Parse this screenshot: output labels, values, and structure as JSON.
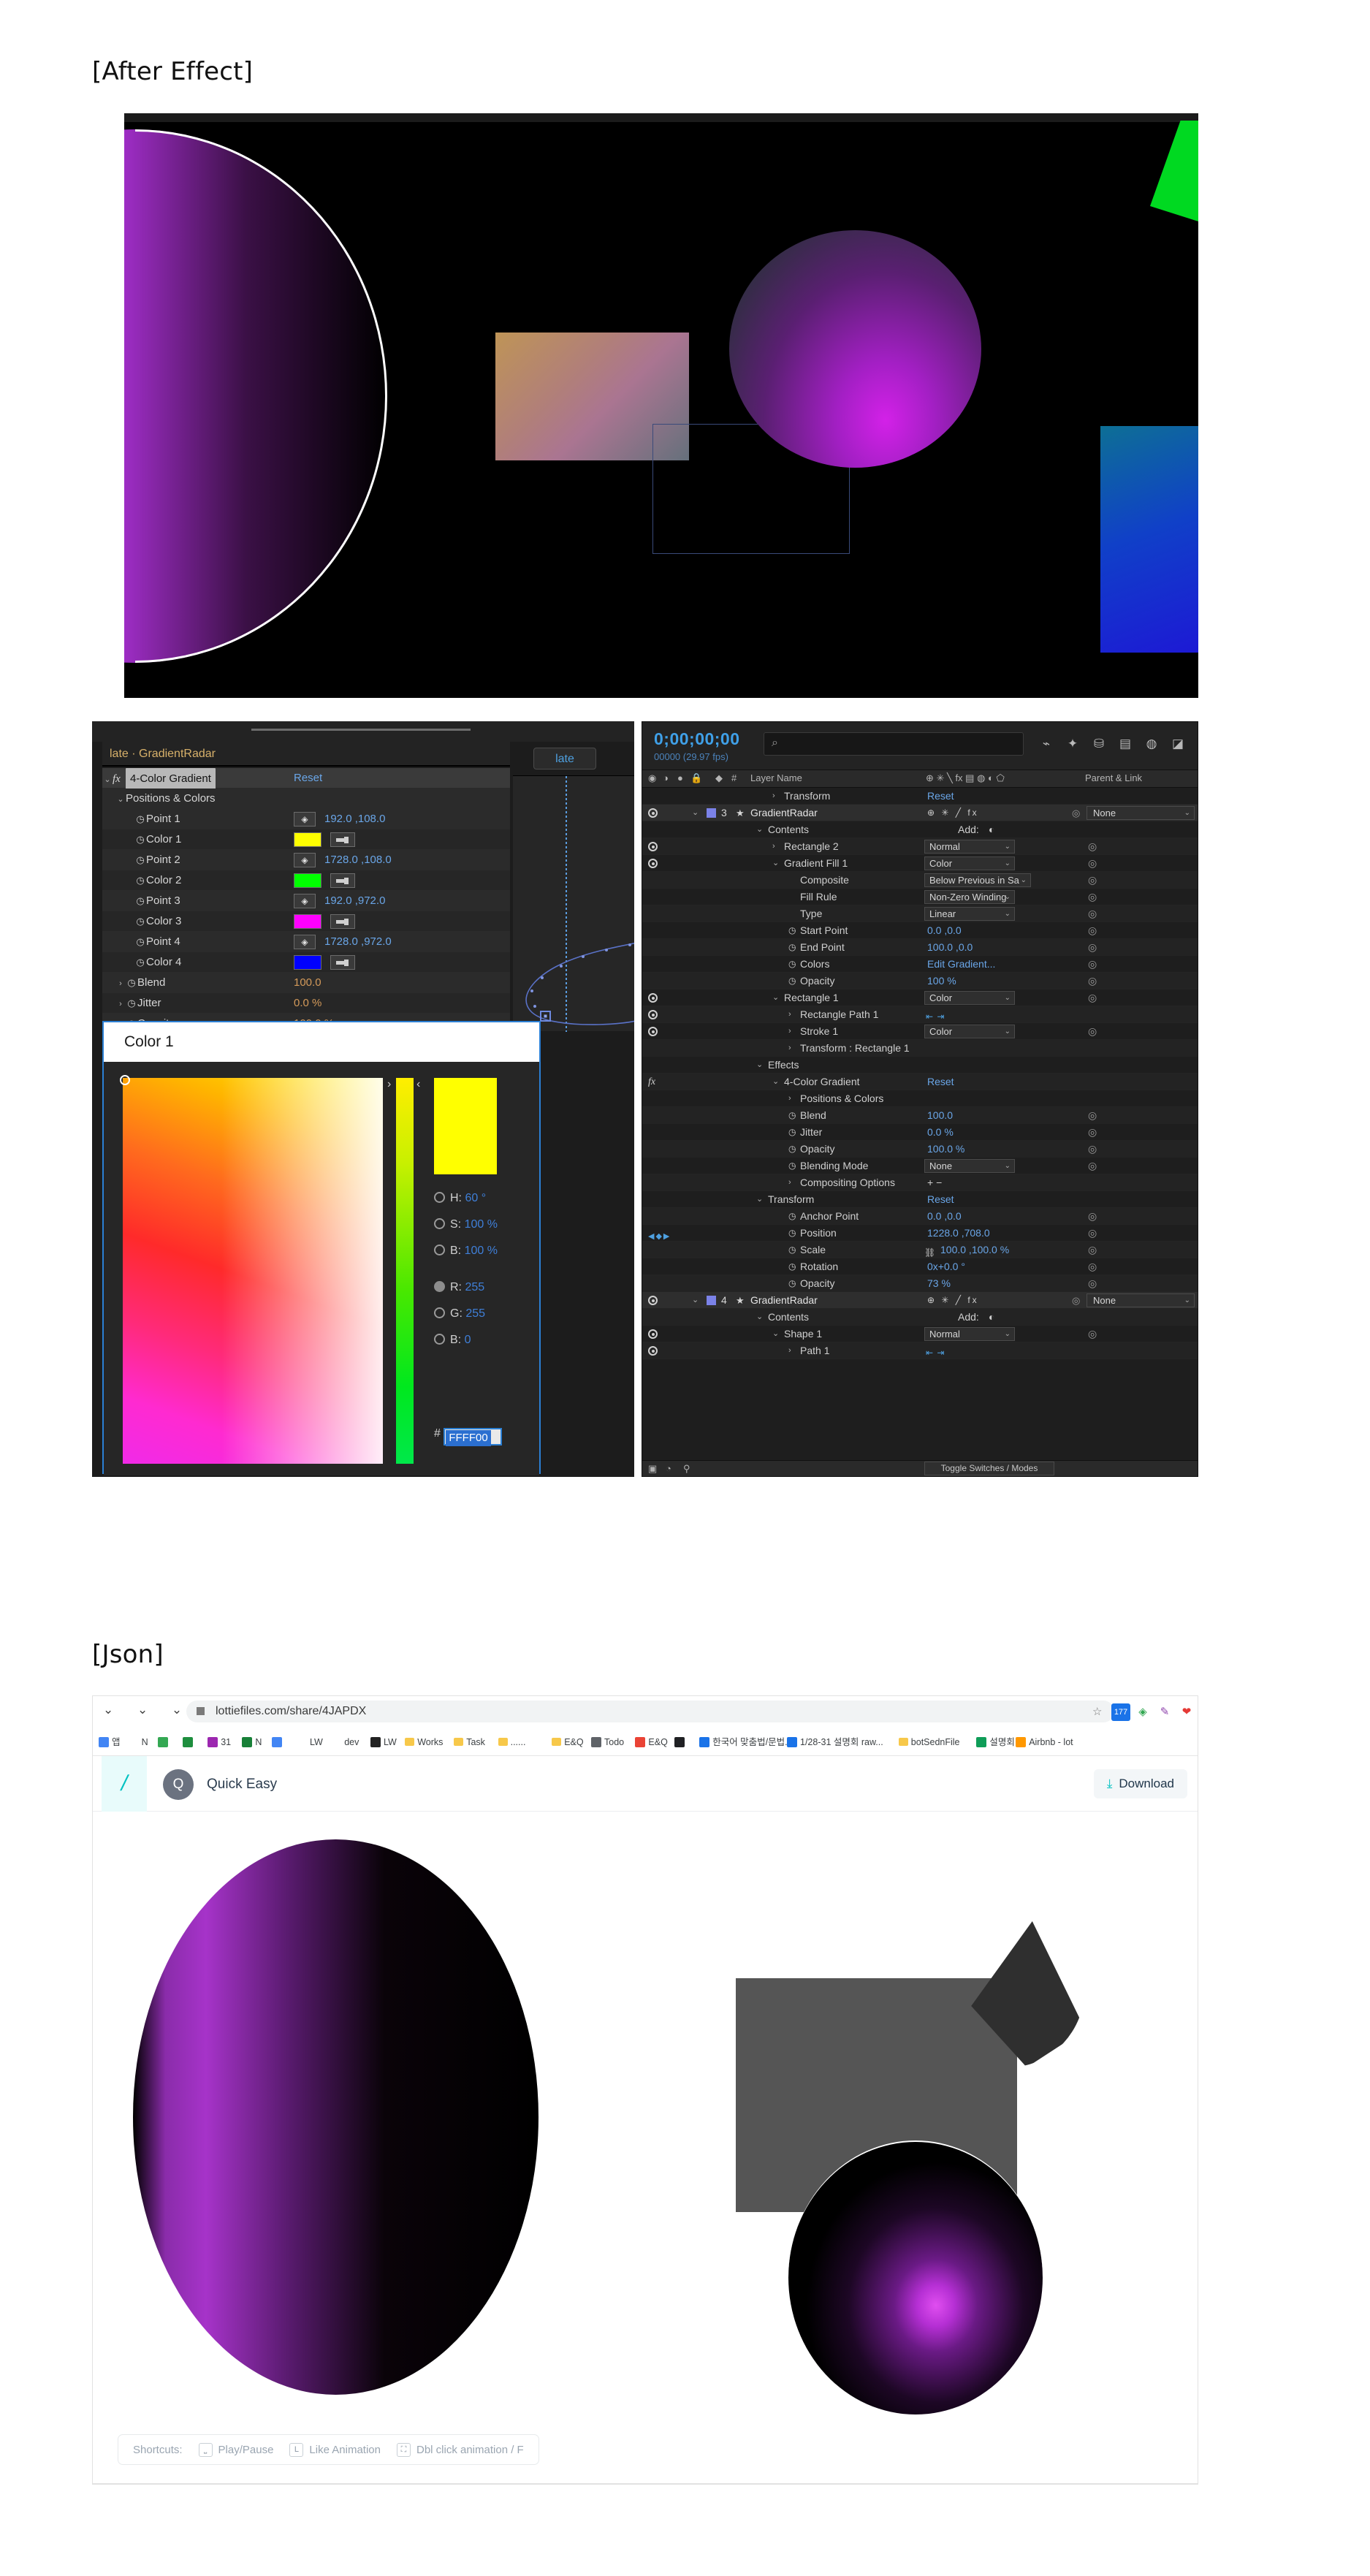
{
  "captions": {
    "after_effect": "[After Effect]",
    "json": "[Json]"
  },
  "after_effects": {
    "effect_controls": {
      "breadcrumb": "late · GradientRadar",
      "effect_name": "4-Color Gradient",
      "reset_label": "Reset",
      "group_label": "Positions & Colors",
      "rows": [
        {
          "label": "Point 1",
          "value": "192.0 ,108.0",
          "kind": "point"
        },
        {
          "label": "Color 1",
          "value": "#FFFF00",
          "kind": "color"
        },
        {
          "label": "Point 2",
          "value": "1728.0 ,108.0",
          "kind": "point"
        },
        {
          "label": "Color 2",
          "value": "#00FF00",
          "kind": "color"
        },
        {
          "label": "Point 3",
          "value": "192.0 ,972.0",
          "kind": "point"
        },
        {
          "label": "Color 3",
          "value": "#FF00FF",
          "kind": "color"
        },
        {
          "label": "Point 4",
          "value": "1728.0 ,972.0",
          "kind": "point"
        },
        {
          "label": "Color 4",
          "value": "#0000FF",
          "kind": "color"
        }
      ],
      "blend_label": "Blend",
      "blend_value": "100.0",
      "jitter_label": "Jitter",
      "jitter_value": "0.0 %",
      "opacity_label": "Opacity",
      "opacity_value": "100.0 %",
      "blending_mode_label": "Blending Mode",
      "blending_mode_value": "None"
    },
    "motion_path": {
      "tab_label": "late"
    },
    "color_picker": {
      "title": "Color 1",
      "hue_label": "H:",
      "hue_value": "60 °",
      "sat_label": "S:",
      "sat_value": "100 %",
      "bri_label": "B:",
      "bri_value": "100 %",
      "red_label": "R:",
      "red_value": "255",
      "green_label": "G:",
      "green_value": "255",
      "blue_label": "B:",
      "blue_value": "0",
      "hash_label": "#",
      "hex_value": "FFFF00",
      "preview_color": "#FFFF00"
    },
    "timeline": {
      "timecode": "0;00;00;00",
      "frame_info": "00000 (29.97 fps)",
      "search_placeholder": "",
      "columns": {
        "layer_name": "Layer Name",
        "parent_link": "Parent & Link"
      },
      "toggle_switches": "Toggle Switches / Modes",
      "add_label": "Add:",
      "rows": [
        {
          "indent": 3,
          "label": "Transform",
          "value": "Reset",
          "type": "reset",
          "chev": "›"
        },
        {
          "indent": 0,
          "label": "GradientRadar",
          "type": "layer",
          "number": "3",
          "parent": "None",
          "switches": "⊕ ✳ ╱ fx"
        },
        {
          "indent": 2,
          "label": "Contents",
          "type": "add",
          "chev": "⌄"
        },
        {
          "indent": 3,
          "label": "Rectangle 2",
          "value": "Normal",
          "type": "dropdown",
          "chev": "›",
          "eye": true
        },
        {
          "indent": 3,
          "label": "Gradient Fill 1",
          "value": "Color",
          "type": "dropdown",
          "chev": "⌄",
          "eye": true
        },
        {
          "indent": 4,
          "label": "Composite",
          "value": "Below Previous in Sa",
          "type": "dropdown"
        },
        {
          "indent": 4,
          "label": "Fill Rule",
          "value": "Non-Zero Winding",
          "type": "dropdown"
        },
        {
          "indent": 4,
          "label": "Type",
          "value": "Linear",
          "type": "dropdown"
        },
        {
          "indent": 4,
          "label": "Start Point",
          "value": "0.0 ,0.0",
          "type": "value",
          "stop": true
        },
        {
          "indent": 4,
          "label": "End Point",
          "value": "100.0 ,0.0",
          "type": "value",
          "stop": true
        },
        {
          "indent": 4,
          "label": "Colors",
          "value": "Edit Gradient...",
          "type": "value",
          "stop": true
        },
        {
          "indent": 4,
          "label": "Opacity",
          "value": "100 %",
          "type": "value",
          "stop": true
        },
        {
          "indent": 3,
          "label": "Rectangle 1",
          "value": "Color",
          "type": "dropdown",
          "chev": "⌄",
          "eye": true
        },
        {
          "indent": 4,
          "label": "Rectangle Path 1",
          "type": "pathicons",
          "chev": "›",
          "eye": true
        },
        {
          "indent": 4,
          "label": "Stroke 1",
          "value": "Color",
          "type": "dropdown",
          "chev": "›",
          "eye": true
        },
        {
          "indent": 4,
          "label": "Transform : Rectangle 1",
          "type": "plain",
          "chev": "›"
        },
        {
          "indent": 2,
          "label": "Effects",
          "type": "plain",
          "chev": "⌄"
        },
        {
          "indent": 3,
          "label": "4-Color Gradient",
          "value": "Reset",
          "type": "reset",
          "chev": "⌄",
          "fx": true
        },
        {
          "indent": 4,
          "label": "Positions & Colors",
          "type": "plain",
          "chev": "›"
        },
        {
          "indent": 4,
          "label": "Blend",
          "value": "100.0",
          "type": "value",
          "stop": true
        },
        {
          "indent": 4,
          "label": "Jitter",
          "value": "0.0 %",
          "type": "value",
          "stop": true
        },
        {
          "indent": 4,
          "label": "Opacity",
          "value": "100.0 %",
          "type": "value",
          "stop": true
        },
        {
          "indent": 4,
          "label": "Blending Mode",
          "value": "None",
          "type": "dropdown",
          "stop": true
        },
        {
          "indent": 4,
          "label": "Compositing Options",
          "value": "+ −",
          "type": "plainval",
          "chev": "›"
        },
        {
          "indent": 2,
          "label": "Transform",
          "value": "Reset",
          "type": "reset",
          "chev": "⌄"
        },
        {
          "indent": 4,
          "label": "Anchor Point",
          "value": "0.0 ,0.0",
          "type": "value",
          "stop": true
        },
        {
          "indent": 4,
          "label": "Position",
          "value": "1228.0 ,708.0",
          "type": "value",
          "stop": true,
          "keyframe": true
        },
        {
          "indent": 4,
          "label": "Scale",
          "value": "100.0 ,100.0 %",
          "type": "value",
          "stop": true,
          "link": true
        },
        {
          "indent": 4,
          "label": "Rotation",
          "value": "0x+0.0 °",
          "type": "value",
          "stop": true
        },
        {
          "indent": 4,
          "label": "Opacity",
          "value": "73 %",
          "type": "value",
          "stop": true
        },
        {
          "indent": 0,
          "label": "GradientRadar",
          "type": "layer",
          "number": "4",
          "parent": "None",
          "switches": "⊕ ✳ ╱ fx"
        },
        {
          "indent": 2,
          "label": "Contents",
          "type": "add",
          "chev": "⌄"
        },
        {
          "indent": 3,
          "label": "Shape 1",
          "value": "Normal",
          "type": "dropdown",
          "chev": "⌄",
          "eye": true
        },
        {
          "indent": 4,
          "label": "Path 1",
          "type": "pathicons",
          "chev": "›",
          "eye": true
        }
      ]
    }
  },
  "json_section": {
    "browser": {
      "url": "lottiefiles.com/share/4JAPDX",
      "bookmarks": [
        {
          "label": "앱",
          "color": "#4285f4",
          "kind": "apps"
        },
        {
          "label": "N",
          "color": "#ffffff",
          "kind": "letter"
        },
        {
          "label": "",
          "color": "#34a853",
          "kind": "sq"
        },
        {
          "label": "",
          "color": "#1e8e3e",
          "kind": "sq"
        },
        {
          "label": "31",
          "color": "#9c27b0",
          "kind": "sq"
        },
        {
          "label": "N",
          "color": "#188038",
          "kind": "sq"
        },
        {
          "label": "",
          "color": "#4285f4",
          "kind": "sq"
        },
        {
          "label": "LW",
          "color": "#ffffff",
          "kind": "letter"
        },
        {
          "label": "dev",
          "color": "#ffffff",
          "kind": "letter"
        },
        {
          "label": "LW",
          "color": "#222222",
          "kind": "letter"
        },
        {
          "label": "Works",
          "color": "#f7c84a",
          "kind": "fold"
        },
        {
          "label": "Task",
          "color": "#f7c84a",
          "kind": "fold"
        },
        {
          "label": "......",
          "color": "#f7c84a",
          "kind": "fold"
        },
        {
          "label": "E&Q",
          "color": "#f7c84a",
          "kind": "fold"
        },
        {
          "label": "Todo",
          "color": "#5f6368",
          "kind": "sq"
        },
        {
          "label": "E&Q",
          "color": "#ea4335",
          "kind": "sq"
        },
        {
          "label": "",
          "color": "#202124",
          "kind": "sq"
        },
        {
          "label": "한국어 맞춤법/문법...",
          "color": "#1a73e8",
          "kind": "sq"
        },
        {
          "label": "1/28-31 설명회 raw...",
          "color": "#1a73e8",
          "kind": "sq"
        },
        {
          "label": "botSednFile",
          "color": "#f7c84a",
          "kind": "fold"
        },
        {
          "label": "설명회",
          "color": "#0f9d58",
          "kind": "sq"
        },
        {
          "label": "Airbnb - lot",
          "color": "#ff9800",
          "kind": "sq"
        }
      ],
      "extensions": [
        "177",
        "ext-green",
        "ext-purple",
        "ext-red",
        "ext-gray"
      ]
    },
    "app": {
      "title": "Quick Easy",
      "avatar_letter": "Q",
      "download_label": "Download",
      "logo_glyph": "/"
    },
    "shortcuts": {
      "label": "Shortcuts:",
      "items": [
        {
          "key": "⎵",
          "text": "Play/Pause"
        },
        {
          "key": "L",
          "text": "Like Animation"
        },
        {
          "key": "⛶",
          "text": "Dbl click animation / F"
        }
      ]
    }
  }
}
